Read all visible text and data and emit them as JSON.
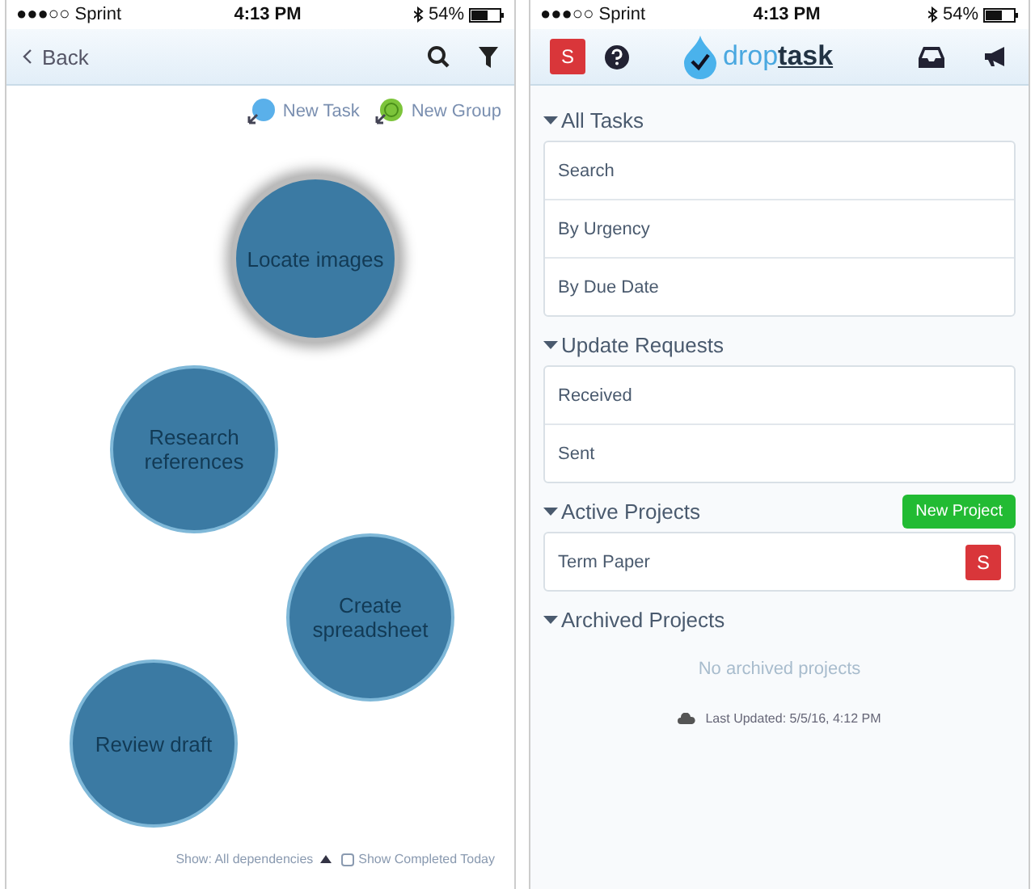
{
  "left_phone": {
    "status_bar": {
      "carrier": "●●●○○ Sprint",
      "time": "4:13 PM",
      "battery": "54%"
    },
    "nav": {
      "back": "Back"
    },
    "toolbar": [
      {
        "label": "New Task",
        "kind": "task"
      },
      {
        "label": "New Group",
        "kind": "group"
      }
    ],
    "bubbles": [
      {
        "label": "Locate images",
        "selected": true
      },
      {
        "label": "Research references",
        "selected": false
      },
      {
        "label": "Create spreadsheet",
        "selected": false
      },
      {
        "label": "Review draft",
        "selected": false
      }
    ],
    "footer": {
      "dependencies": "Show: All dependencies",
      "completed": {
        "label": "Show Completed Today",
        "checked": false
      }
    }
  },
  "right_phone": {
    "status_bar": {
      "carrier": "●●●○○ Sprint",
      "time": "4:13 PM",
      "battery": "54%"
    },
    "header": {
      "avatar": "S",
      "logo_light": "drop",
      "logo_bold": "task"
    },
    "sections": [
      {
        "title": "All Tasks",
        "items": [
          {
            "label": "Search"
          },
          {
            "label": "By Urgency"
          },
          {
            "label": "By Due Date"
          }
        ]
      },
      {
        "title": "Update Requests",
        "items": [
          {
            "label": "Received"
          },
          {
            "label": "Sent"
          }
        ]
      },
      {
        "title": "Active Projects",
        "button": "New Project",
        "items": [
          {
            "label": "Term Paper",
            "badge": "S"
          }
        ]
      },
      {
        "title": "Archived Projects",
        "empty": "No archived projects"
      }
    ],
    "last_updated": "Last Updated: 5/5/16, 4:12 PM"
  }
}
